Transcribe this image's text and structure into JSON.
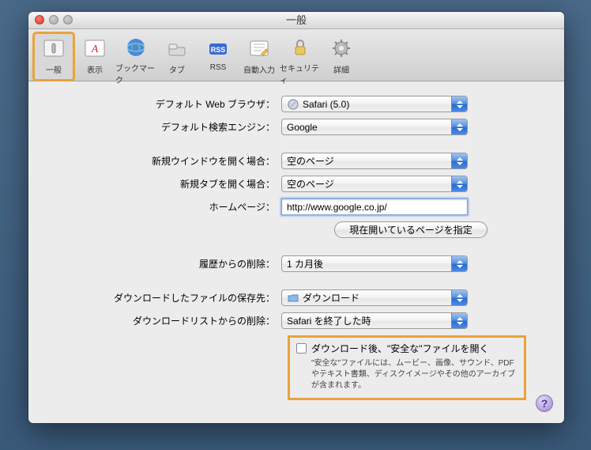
{
  "window": {
    "title": "一般"
  },
  "toolbar": {
    "items": [
      {
        "id": "general",
        "label": "一般",
        "icon": "switch-icon",
        "selected": true
      },
      {
        "id": "appearance",
        "label": "表示",
        "icon": "font-icon"
      },
      {
        "id": "bookmarks",
        "label": "ブックマーク",
        "icon": "globe-icon"
      },
      {
        "id": "tabs",
        "label": "タブ",
        "icon": "tab-icon"
      },
      {
        "id": "rss",
        "label": "RSS",
        "icon": "rss-icon"
      },
      {
        "id": "autofill",
        "label": "自動入力",
        "icon": "pencil-icon"
      },
      {
        "id": "security",
        "label": "セキュリティ",
        "icon": "lock-icon"
      },
      {
        "id": "advanced",
        "label": "詳細",
        "icon": "gear-icon"
      }
    ]
  },
  "rows": {
    "default_browser_label": "デフォルト Web ブラウザ：",
    "default_browser_value": "Safari (5.0)",
    "default_search_label": "デフォルト検索エンジン：",
    "default_search_value": "Google",
    "new_window_label": "新規ウインドウを開く場合：",
    "new_window_value": "空のページ",
    "new_tab_label": "新規タブを開く場合：",
    "new_tab_value": "空のページ",
    "homepage_label": "ホームページ：",
    "homepage_value": "http://www.google.co.jp/",
    "set_current_button": "現在開いているページを指定",
    "history_label": "履歴からの削除：",
    "history_value": "1 カ月後",
    "download_loc_label": "ダウンロードしたファイルの保存先：",
    "download_loc_value": "ダウンロード",
    "download_list_label": "ダウンロードリストからの削除：",
    "download_list_value": "Safari を終了した時"
  },
  "safe": {
    "main": "ダウンロード後、\"安全な\"ファイルを開く",
    "sub": "\"安全な\"ファイルには、ムービー、画像、サウンド、PDF やテキスト書類、ディスクイメージやその他のアーカイブが含まれます。"
  },
  "help_glyph": "?"
}
